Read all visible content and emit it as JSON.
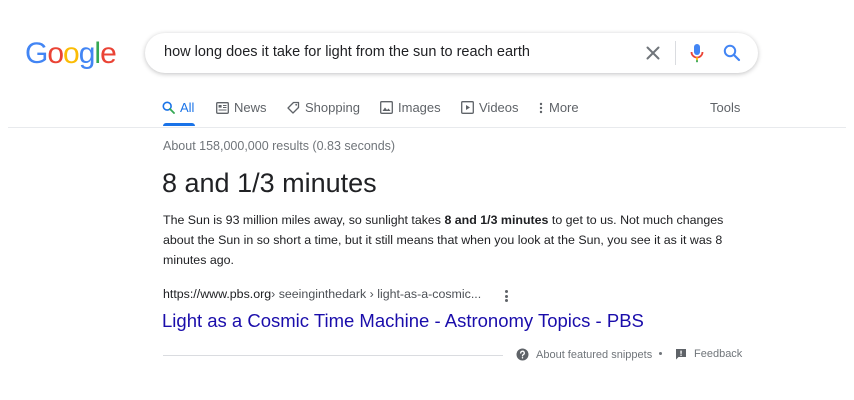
{
  "logo": {
    "text": "Google"
  },
  "search": {
    "query": "how long does it take for light from the sun to reach earth"
  },
  "tabs": [
    {
      "label": "All",
      "icon": "search-icon",
      "active": true
    },
    {
      "label": "News",
      "icon": "news-icon"
    },
    {
      "label": "Shopping",
      "icon": "tag-icon"
    },
    {
      "label": "Images",
      "icon": "image-icon"
    },
    {
      "label": "Videos",
      "icon": "video-icon"
    },
    {
      "label": "More",
      "icon": "more-vert-icon"
    }
  ],
  "tools_label": "Tools",
  "results_stats": "About 158,000,000 results (0.83 seconds)",
  "featured_snippet": {
    "answer": "8 and 1/3 minutes",
    "text_before": "The Sun is 93 million miles away, so sunlight takes ",
    "text_bold": "8 and 1/3 minutes",
    "text_after": " to get to us. Not much changes about the Sun in so short a time, but it still means that when you look at the Sun, you see it as it was 8 minutes ago.",
    "cite_url": "https://www.pbs.org",
    "cite_path": " › seeinginthedark › light-as-a-cosmic...",
    "title": "Light as a Cosmic Time Machine - Astronomy Topics - PBS"
  },
  "footer": {
    "about_label": "About featured snippets",
    "feedback_label": "Feedback"
  },
  "colors": {
    "accent": "#1a73e8",
    "link": "#1a0dab",
    "google_blue": "#4285F4",
    "google_red": "#EA4335",
    "google_yellow": "#FBBC05",
    "google_green": "#34A853"
  }
}
